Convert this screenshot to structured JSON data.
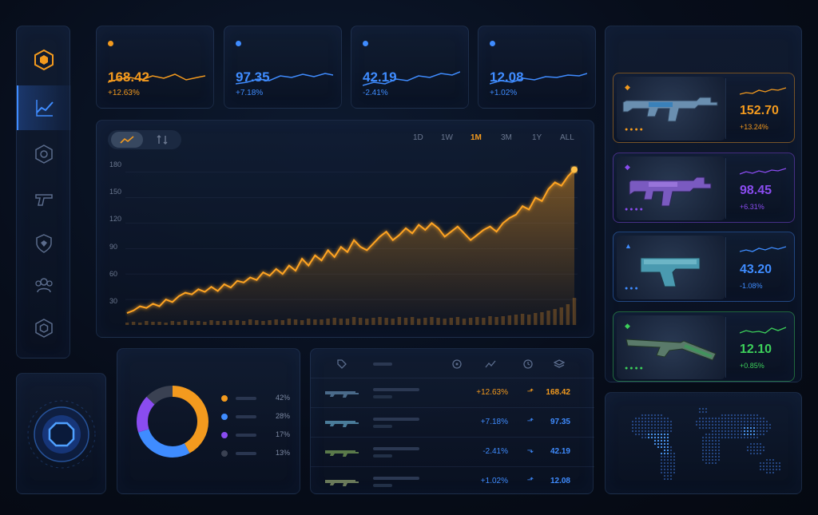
{
  "colors": {
    "orange": "#f39a1e",
    "blue": "#3f8cff",
    "purple": "#8a4cf0",
    "green": "#3ccf5a",
    "grey": "#3a4152"
  },
  "sidebar": {
    "items": [
      {
        "icon": "hexagon-logo-icon"
      },
      {
        "icon": "trending-chart-icon",
        "active": true
      },
      {
        "icon": "crosshair-icon"
      },
      {
        "icon": "pistol-icon"
      },
      {
        "icon": "shield-icon"
      },
      {
        "icon": "users-icon"
      },
      {
        "icon": "hexagon-settings-icon"
      }
    ]
  },
  "stats": [
    {
      "value": "168.42",
      "change": "+12.63%",
      "color": "#f39a1e"
    },
    {
      "value": "97.35",
      "change": "+7.18%",
      "color": "#3f8cff"
    },
    {
      "value": "42.19",
      "change": "-2.41%",
      "color": "#3f8cff"
    },
    {
      "value": "12.08",
      "change": "+1.02%",
      "color": "#3f8cff"
    }
  ],
  "chart": {
    "ranges": [
      "1D",
      "1W",
      "1M",
      "3M",
      "1Y",
      "ALL"
    ],
    "active_range": "1M",
    "yticks": [
      "180",
      "150",
      "120",
      "90",
      "60",
      "30"
    ]
  },
  "chart_data": {
    "type": "area",
    "ylim": [
      0,
      190
    ],
    "grid": true,
    "values": [
      14,
      17,
      22,
      20,
      25,
      22,
      30,
      27,
      34,
      38,
      36,
      42,
      39,
      45,
      40,
      48,
      44,
      52,
      50,
      56,
      53,
      62,
      58,
      66,
      60,
      70,
      64,
      78,
      70,
      82,
      76,
      88,
      80,
      92,
      86,
      100,
      92,
      88,
      96,
      104,
      110,
      100,
      106,
      114,
      108,
      118,
      112,
      120,
      114,
      104,
      110,
      116,
      108,
      100,
      106,
      112,
      116,
      110,
      120,
      126,
      130,
      140,
      136,
      150,
      146,
      160,
      168,
      164,
      175,
      183
    ],
    "volume": [
      3,
      4,
      3,
      5,
      4,
      4,
      3,
      5,
      4,
      6,
      5,
      5,
      4,
      6,
      5,
      5,
      6,
      6,
      5,
      7,
      6,
      5,
      6,
      7,
      6,
      8,
      7,
      6,
      8,
      7,
      7,
      8,
      9,
      8,
      8,
      10,
      9,
      8,
      9,
      10,
      9,
      8,
      10,
      9,
      10,
      8,
      9,
      10,
      9,
      8,
      9,
      10,
      8,
      9,
      10,
      9,
      11,
      10,
      11,
      12,
      13,
      14,
      13,
      15,
      16,
      18,
      20,
      22,
      26,
      34
    ]
  },
  "donut": {
    "segments": [
      {
        "label_pct": "42%",
        "value": 42,
        "color": "#f39a1e"
      },
      {
        "label_pct": "28%",
        "value": 28,
        "color": "#3f8cff"
      },
      {
        "label_pct": "17%",
        "value": 17,
        "color": "#8a4cf0"
      },
      {
        "label_pct": "13%",
        "value": 13,
        "color": "#3a4152"
      }
    ]
  },
  "table": {
    "header_icons": [
      "tag-icon",
      "rarity-icon",
      "trend-icon",
      "clock-icon",
      "layers-icon"
    ],
    "rows": [
      {
        "change": "+12.63%",
        "price": "168.42",
        "color": "#f39a1e",
        "arrow": "up"
      },
      {
        "change": "+7.18%",
        "price": "97.35",
        "color": "#3f8cff",
        "arrow": "up"
      },
      {
        "change": "-2.41%",
        "price": "42.19",
        "color": "#3f8cff",
        "arrow": "down"
      },
      {
        "change": "+1.02%",
        "price": "12.08",
        "color": "#3f8cff",
        "arrow": "up"
      }
    ]
  },
  "items": [
    {
      "value": "152.70",
      "change": "+13.24%",
      "color": "#f39a1e",
      "weapon": "rifle"
    },
    {
      "value": "98.45",
      "change": "+6.31%",
      "color": "#8a4cf0",
      "weapon": "smg"
    },
    {
      "value": "43.20",
      "change": "-1.08%",
      "color": "#3f8cff",
      "weapon": "pistol"
    },
    {
      "value": "12.10",
      "change": "+0.85%",
      "color": "#3ccf5a",
      "weapon": "shotgun"
    }
  ]
}
